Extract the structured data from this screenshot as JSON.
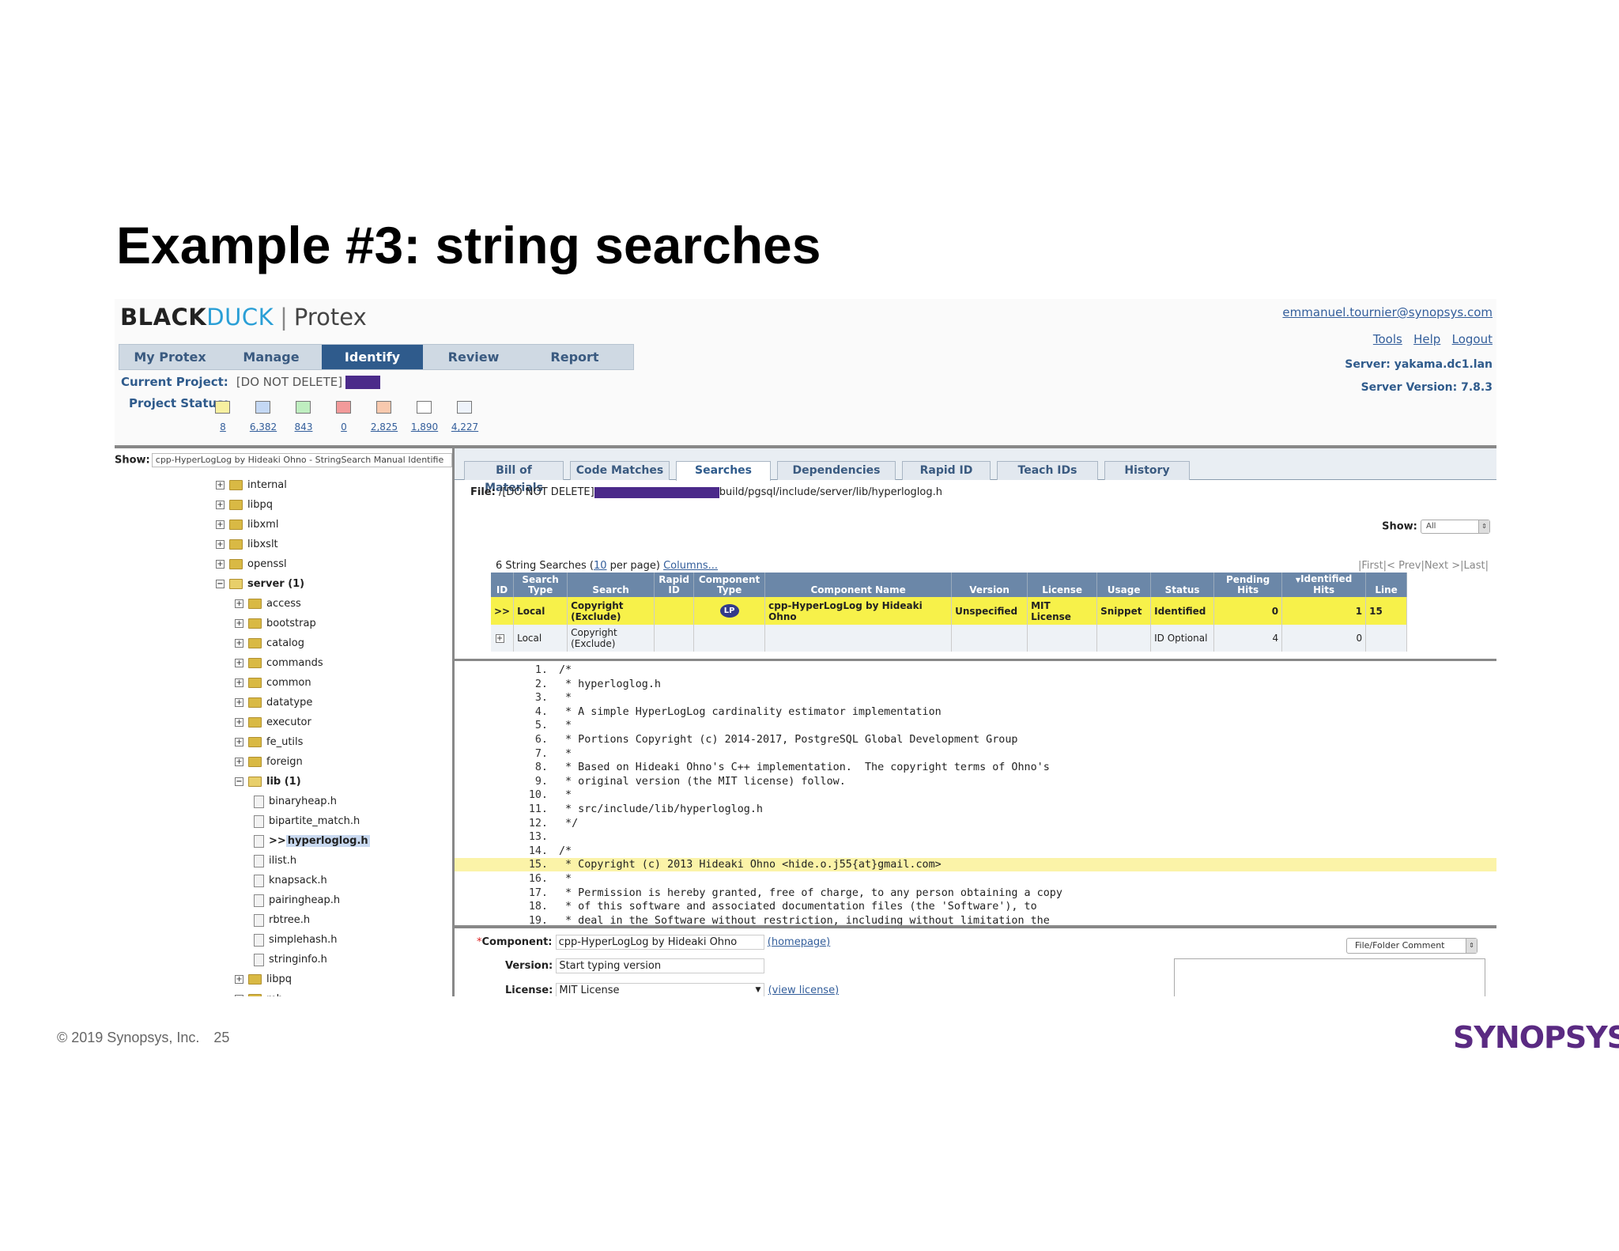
{
  "slide": {
    "title": "Example #3: string searches",
    "footer": "© 2019 Synopsys, Inc.",
    "page_number": "25",
    "brand": "SYNOPSYS"
  },
  "app": {
    "logo": {
      "black": "BLACK",
      "duck": "DUCK",
      "sep": "|",
      "product": "Protex"
    },
    "nav_tabs": [
      "My Protex",
      "Manage",
      "Identify",
      "Review",
      "Report"
    ],
    "active_nav": "Identify",
    "current_project_label": "Current Project:",
    "current_project_value": "[DO NOT DELETE]",
    "project_status_label": "Project Status:",
    "status_counts": [
      {
        "color": "#f7f0a0",
        "count": "8"
      },
      {
        "color": "#c4d8f4",
        "count": "6,382"
      },
      {
        "color": "#bfeec0",
        "count": "843"
      },
      {
        "color": "#f29a9a",
        "count": "0"
      },
      {
        "color": "#f8c9ae",
        "count": "2,825"
      },
      {
        "color": "#ffffff",
        "count": "1,890"
      },
      {
        "color": "#eef3fb",
        "count": "4,227"
      }
    ],
    "user_email": "emmanuel.tournier@synopsys.com",
    "links": [
      "Tools",
      "Help",
      "Logout"
    ],
    "server_label": "Server:",
    "server_value": "yakama.dc1.lan",
    "server_version_label": "Server Version:",
    "server_version_value": "7.8.3"
  },
  "tree": {
    "show_label": "Show:",
    "show_value": "cpp-HyperLogLog by Hideaki Ohno - StringSearch Manual Identifie",
    "nodes": [
      {
        "label": "internal",
        "level": 0,
        "type": "folder",
        "toggle": "+"
      },
      {
        "label": "libpq",
        "level": 0,
        "type": "folder",
        "toggle": "+"
      },
      {
        "label": "libxml",
        "level": 0,
        "type": "folder",
        "toggle": "+"
      },
      {
        "label": "libxslt",
        "level": 0,
        "type": "folder",
        "toggle": "+"
      },
      {
        "label": "openssl",
        "level": 0,
        "type": "folder",
        "toggle": "+"
      },
      {
        "label": "server (1)",
        "level": 0,
        "type": "folder-open",
        "toggle": "−",
        "bold": true
      },
      {
        "label": "access",
        "level": 1,
        "type": "folder",
        "toggle": "+"
      },
      {
        "label": "bootstrap",
        "level": 1,
        "type": "folder",
        "toggle": "+"
      },
      {
        "label": "catalog",
        "level": 1,
        "type": "folder",
        "toggle": "+"
      },
      {
        "label": "commands",
        "level": 1,
        "type": "folder",
        "toggle": "+"
      },
      {
        "label": "common",
        "level": 1,
        "type": "folder",
        "toggle": "+"
      },
      {
        "label": "datatype",
        "level": 1,
        "type": "folder",
        "toggle": "+"
      },
      {
        "label": "executor",
        "level": 1,
        "type": "folder",
        "toggle": "+"
      },
      {
        "label": "fe_utils",
        "level": 1,
        "type": "folder",
        "toggle": "+"
      },
      {
        "label": "foreign",
        "level": 1,
        "type": "folder",
        "toggle": "+"
      },
      {
        "label": "lib (1)",
        "level": 1,
        "type": "folder-open",
        "toggle": "−",
        "bold": true
      },
      {
        "label": "binaryheap.h",
        "level": 2,
        "type": "file"
      },
      {
        "label": "bipartite_match.h",
        "level": 2,
        "type": "file"
      },
      {
        "label": "hyperloglog.h",
        "level": 2,
        "type": "file",
        "selected": true,
        "prefix": ">>"
      },
      {
        "label": "ilist.h",
        "level": 2,
        "type": "file"
      },
      {
        "label": "knapsack.h",
        "level": 2,
        "type": "file"
      },
      {
        "label": "pairingheap.h",
        "level": 2,
        "type": "file"
      },
      {
        "label": "rbtree.h",
        "level": 2,
        "type": "file"
      },
      {
        "label": "simplehash.h",
        "level": 2,
        "type": "file"
      },
      {
        "label": "stringinfo.h",
        "level": 2,
        "type": "file"
      },
      {
        "label": "libpq",
        "level": 1,
        "type": "folder",
        "toggle": "+"
      },
      {
        "label": "mb",
        "level": 1,
        "type": "folder",
        "toggle": "+"
      }
    ]
  },
  "panel": {
    "tabs": [
      "Bill of Materials",
      "Code Matches",
      "Searches",
      "Dependencies",
      "Rapid ID",
      "Teach IDs",
      "History"
    ],
    "active_tab": "Searches",
    "file_label": "File:",
    "file_prefix": "/[DO NOT DELETE]",
    "file_suffix": "build/pgsql/include/server/lib/hyperloglog.h",
    "show_label": "Show:",
    "show_value": "All",
    "searches_info": {
      "prefix": "6 String Searches (",
      "per_page": "10",
      "suffix": " per page)",
      "columns": "Columns..."
    },
    "pager": {
      "first": "|First|",
      "prev": "< Prev",
      "next": "|Next >",
      "last": "|Last|"
    },
    "columns": [
      "ID",
      "Search Type",
      "Search",
      "Rapid ID",
      "Component Type",
      "Component Name",
      "Version",
      "License",
      "Usage",
      "Status",
      "Pending Hits",
      "Identified Hits",
      "Line"
    ],
    "rows": [
      {
        "id": ">>",
        "search_type": "Local",
        "search": "Copyright (Exclude)",
        "rapid_id": "",
        "component_type": "LP",
        "component_name": "cpp-HyperLogLog by Hideaki Ohno",
        "version": "Unspecified",
        "license": "MIT License",
        "usage": "Snippet",
        "status": "Identified",
        "pending": "0",
        "identified": "1",
        "line": "15"
      },
      {
        "id": "+",
        "search_type": "Local",
        "search": "Copyright (Exclude)",
        "rapid_id": "",
        "component_type": "",
        "component_name": "",
        "version": "",
        "license": "",
        "usage": "",
        "status": "ID Optional",
        "pending": "4",
        "identified": "0",
        "line": ""
      }
    ],
    "code_lines": [
      {
        "n": "1.",
        "t": "/*"
      },
      {
        "n": "2.",
        "t": " * hyperloglog.h"
      },
      {
        "n": "3.",
        "t": " *"
      },
      {
        "n": "4.",
        "t": " * A simple HyperLogLog cardinality estimator implementation"
      },
      {
        "n": "5.",
        "t": " *"
      },
      {
        "n": "6.",
        "t": " * Portions Copyright (c) 2014-2017, PostgreSQL Global Development Group"
      },
      {
        "n": "7.",
        "t": " *"
      },
      {
        "n": "8.",
        "t": " * Based on Hideaki Ohno's C++ implementation.  The copyright terms of Ohno's"
      },
      {
        "n": "9.",
        "t": " * original version (the MIT license) follow."
      },
      {
        "n": "10.",
        "t": " *"
      },
      {
        "n": "11.",
        "t": " * src/include/lib/hyperloglog.h"
      },
      {
        "n": "12.",
        "t": " */"
      },
      {
        "n": "13.",
        "t": ""
      },
      {
        "n": "14.",
        "t": "/*"
      },
      {
        "n": "15.",
        "t": " * Copyright (c) 2013 Hideaki Ohno <hide.o.j55{at}gmail.com>",
        "highlight": true
      },
      {
        "n": "16.",
        "t": " *"
      },
      {
        "n": "17.",
        "t": " * Permission is hereby granted, free of charge, to any person obtaining a copy"
      },
      {
        "n": "18.",
        "t": " * of this software and associated documentation files (the 'Software'), to"
      },
      {
        "n": "19.",
        "t": " * deal in the Software without restriction, including without limitation the"
      }
    ],
    "form": {
      "required_mark": "*",
      "component_label": "Component:",
      "component_value": "cpp-HyperLogLog by Hideaki Ohno",
      "homepage_link": "(homepage)",
      "version_label": "Version:",
      "version_placeholder": "Start typing version",
      "license_label": "License:",
      "license_value": "MIT License",
      "view_license_link": "(view license)",
      "comment_select": "File/Folder Comment"
    }
  }
}
